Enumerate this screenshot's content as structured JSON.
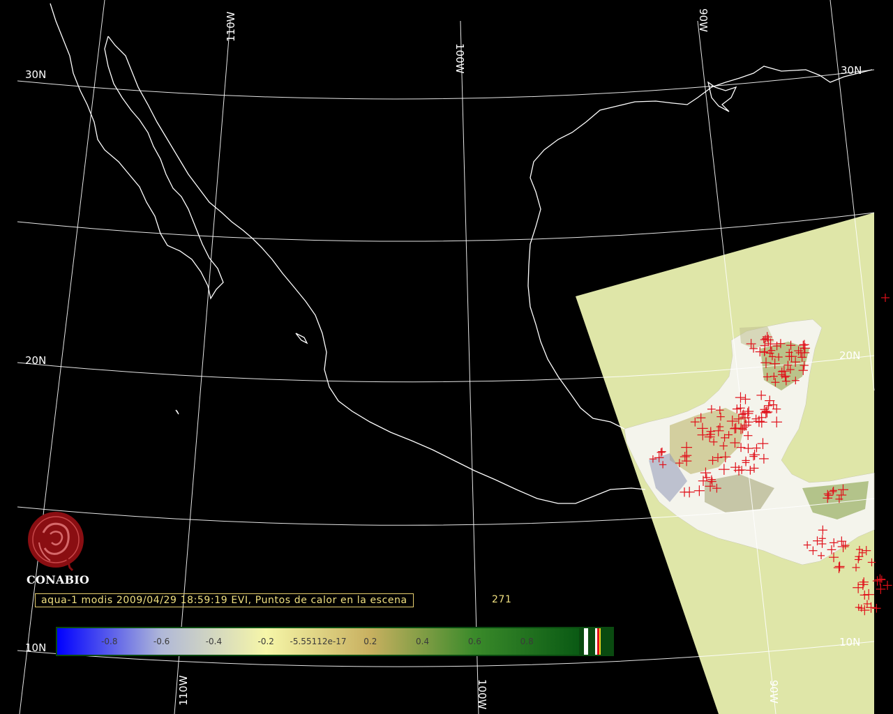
{
  "map": {
    "grid_labels": {
      "lat_30n_left": "30N",
      "lat_30n_right": "30N",
      "lat_20n_left": "20N",
      "lat_20n_right": "20N",
      "lat_10n_left": "10N",
      "lat_10n_right": "10N",
      "lon_110w_top": "110W",
      "lon_100w_top": "100W",
      "lon_90w_top": "90W",
      "lon_110w_bottom": "110W",
      "lon_100w_bottom": "100W",
      "lon_90w_bottom": "90W"
    },
    "colors": {
      "background": "#000000",
      "grid": "#ffffff",
      "coastline": "#ffffff",
      "scene": "#dfe6a8",
      "hotspot": "#e0101a"
    },
    "hotspot_icon": "red-cross-marker"
  },
  "logo": {
    "icon": "conabio-logo-icon",
    "text": "CONABIO"
  },
  "caption": {
    "text": "aqua-1 modis 2009/04/29 18:59:19 EVI, Puntos de calor en la escena",
    "count": "271"
  },
  "colorbar": {
    "labels": [
      "-0.8",
      "-0.6",
      "-0.4",
      "-0.2",
      "-5.55112e-17",
      "0.2",
      "0.4",
      "0.6",
      "0.8"
    ],
    "values": [
      -0.8,
      -0.6,
      -0.4,
      -0.2,
      0.0,
      0.2,
      0.4,
      0.6,
      0.8
    ],
    "range": [
      -1.0,
      1.0
    ],
    "gradient_colors": [
      "#0000ff",
      "#b0b8d8",
      "#f6f6a8",
      "#c8b060",
      "#3a8a2a",
      "#0a5a14"
    ]
  }
}
